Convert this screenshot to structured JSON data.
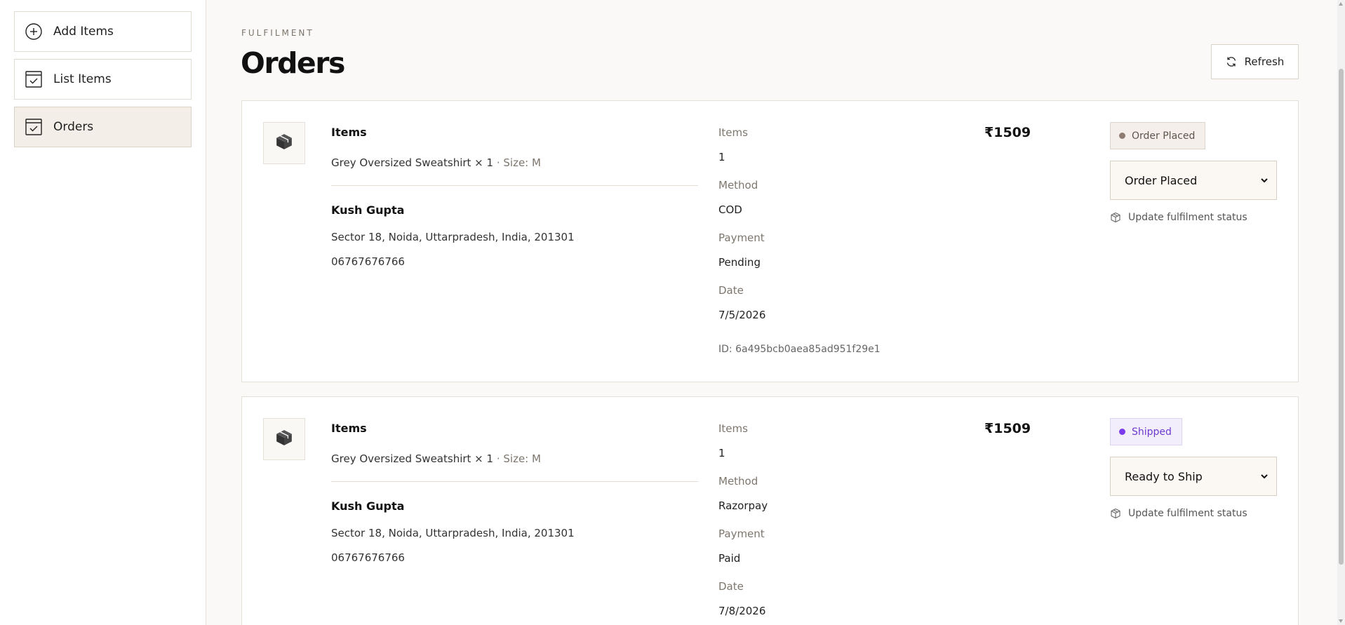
{
  "sidebar": {
    "items": [
      {
        "label": "Add Items",
        "icon": "plus-circle-icon"
      },
      {
        "label": "List Items",
        "icon": "checklist-icon"
      },
      {
        "label": "Orders",
        "icon": "checklist-icon"
      }
    ],
    "active": "Orders"
  },
  "header": {
    "eyebrow": "FULFILMENT",
    "title": "Orders",
    "refresh_label": "Refresh"
  },
  "labels": {
    "items_heading": "Items",
    "items": "Items",
    "method": "Method",
    "payment": "Payment",
    "date": "Date",
    "hint": "Update fulfilment status"
  },
  "orders": [
    {
      "item_line": "Grey Oversized Sweatshirt × 1",
      "size": " · Size: M",
      "customer_name": "Kush Gupta",
      "address": "Sector 18, Noida, Uttarpradesh, India, 201301",
      "phone": "06767676766",
      "items_count": "1",
      "method": "COD",
      "payment": "Pending",
      "date": "7/5/2026",
      "id": "ID: 6a495bcb0aea85ad951f29e1",
      "price": "₹1509",
      "badge": "Order Placed",
      "badge_color": "#8e7b72",
      "status_select": "Order Placed"
    },
    {
      "item_line": "Grey Oversized Sweatshirt × 1",
      "size": " · Size: M",
      "customer_name": "Kush Gupta",
      "address": "Sector 18, Noida, Uttarpradesh, India, 201301",
      "phone": "06767676766",
      "items_count": "1",
      "method": "Razorpay",
      "payment": "Paid",
      "date": "7/8/2026",
      "price": "₹1509",
      "badge": "Shipped",
      "badge_color": "#7c3aed",
      "status_select": "Ready to Ship"
    }
  ],
  "colors": {
    "background": "#faf9f7",
    "active_nav": "#f3eee7",
    "border": "#e5e0d8"
  }
}
